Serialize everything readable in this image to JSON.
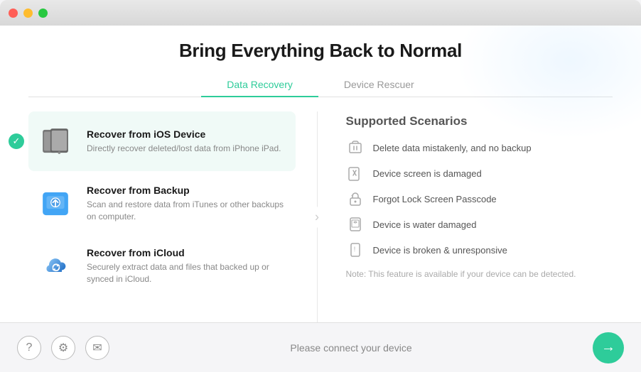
{
  "titleBar": {
    "trafficLights": [
      "close",
      "minimize",
      "maximize"
    ]
  },
  "header": {
    "title": "Bring Everything Back to Normal"
  },
  "tabs": [
    {
      "id": "data-recovery",
      "label": "Data Recovery",
      "active": true
    },
    {
      "id": "device-rescuer",
      "label": "Device Rescuer",
      "active": false
    }
  ],
  "recoveryOptions": [
    {
      "id": "ios-device",
      "title": "Recover from iOS Device",
      "description": "Directly recover deleted/lost data from iPhone iPad.",
      "icon": "ios-device-icon",
      "selected": true
    },
    {
      "id": "backup",
      "title": "Recover from Backup",
      "description": "Scan and restore data from iTunes or other backups on computer.",
      "icon": "backup-icon",
      "selected": false
    },
    {
      "id": "icloud",
      "title": "Recover from iCloud",
      "description": "Securely extract data and files that backed up or synced in iCloud.",
      "icon": "icloud-icon",
      "selected": false
    }
  ],
  "scenarios": {
    "title": "Supported Scenarios",
    "items": [
      {
        "id": "delete-mistakenly",
        "text": "Delete data mistakenly, and no backup",
        "icon": "delete-icon"
      },
      {
        "id": "screen-damaged",
        "text": "Device screen is damaged",
        "icon": "screen-icon"
      },
      {
        "id": "forgot-passcode",
        "text": "Forgot Lock Screen Passcode",
        "icon": "lock-icon"
      },
      {
        "id": "water-damaged",
        "text": "Device is water damaged",
        "icon": "water-icon"
      },
      {
        "id": "broken",
        "text": "Device is broken & unresponsive",
        "icon": "broken-icon"
      }
    ],
    "note": "Note: This feature is available if your device can be detected."
  },
  "footer": {
    "statusText": "Please connect your device",
    "icons": {
      "help": "?",
      "settings": "⚙",
      "email": "✉"
    },
    "nextArrow": "→"
  }
}
